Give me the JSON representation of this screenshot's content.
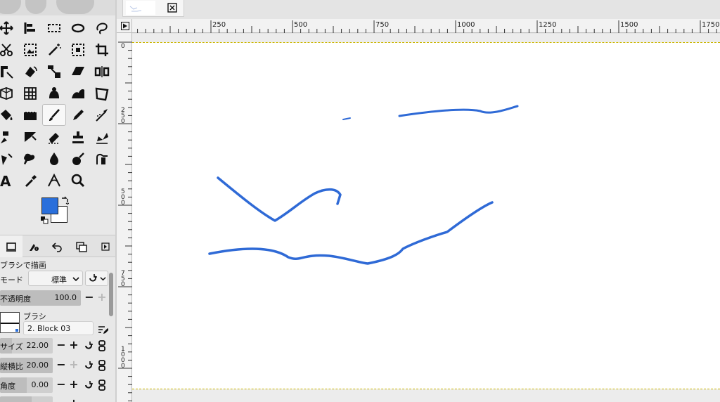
{
  "image_tab": {
    "close_icon": "close-box-icon"
  },
  "tools": [
    "move-icon",
    "align-icon",
    "rect-select-icon",
    "ellipse-select-icon",
    "lasso-icon",
    "scissors-select-icon",
    "foreground-select-icon",
    "fuzzy-select-icon",
    "color-select-icon",
    "crop-icon",
    "unified-transform-icon",
    "rotate-icon",
    "scale-icon",
    "shear-icon",
    "flip-icon",
    "perspective-icon",
    "grid-transform-icon",
    "cage-icon",
    "warp-icon",
    "handle-transform-icon",
    "bucket-fill-icon",
    "gradient-icon",
    "paintbrush-icon",
    "pencil-icon",
    "airbrush-icon",
    "mypaint-brush-icon",
    "ink-icon",
    "eraser-icon",
    "clone-icon",
    "heal-icon",
    "smudge-icon",
    "blur-icon",
    "dodge-icon",
    "burn-icon",
    "paths-icon",
    "text-icon",
    "color-picker-icon",
    "measure-icon",
    "zoom-icon"
  ],
  "colors": {
    "foreground": "#2a6fdb",
    "background": "#ffffff"
  },
  "dock_tabs": [
    "tool-options-tab",
    "device-status-tab",
    "undo-history-tab",
    "images-tab",
    "tab-menu"
  ],
  "tool_options": {
    "title": "ブラシで描画",
    "mode_label": "モード",
    "mode_value": "標準",
    "opacity_label": "不透明度",
    "opacity_value": "100.0",
    "brush_label": "ブラシ",
    "brush_name": "2. Block 03",
    "size_label": "サイズ",
    "size_value": "22.00",
    "aspect_label": "縦横比",
    "aspect_value": "20.00",
    "angle_label": "角度",
    "angle_value": "0.00"
  },
  "ruler": {
    "h_labels": [
      "250",
      "500",
      "750",
      "1000",
      "1250",
      "1500",
      "1750"
    ],
    "v_labels": [
      "0",
      "250",
      "500",
      "750",
      "1000"
    ]
  },
  "accent": "#2a6fdb"
}
